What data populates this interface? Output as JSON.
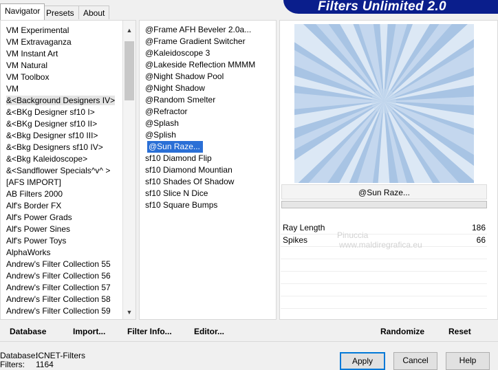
{
  "tabs": [
    {
      "label": "Navigator",
      "active": true
    },
    {
      "label": "Presets",
      "active": false
    },
    {
      "label": "About",
      "active": false
    }
  ],
  "app_title": "Filters Unlimited 2.0",
  "categories": [
    {
      "label": "VM Experimental"
    },
    {
      "label": "VM Extravaganza"
    },
    {
      "label": "VM Instant Art"
    },
    {
      "label": "VM Natural"
    },
    {
      "label": "VM Toolbox"
    },
    {
      "label": "VM"
    },
    {
      "label": "&<Background Designers IV>",
      "selected": true
    },
    {
      "label": "&<BKg Designer sf10 I>"
    },
    {
      "label": "&<BKg Designer sf10 II>"
    },
    {
      "label": "&<Bkg Designer sf10 III>"
    },
    {
      "label": "&<Bkg Designers sf10 IV>"
    },
    {
      "label": "&<Bkg Kaleidoscope>"
    },
    {
      "label": "&<Sandflower Specials^v^ >"
    },
    {
      "label": "[AFS IMPORT]"
    },
    {
      "label": "AB Filters 2000"
    },
    {
      "label": "Alf's Border FX"
    },
    {
      "label": "Alf's Power Grads"
    },
    {
      "label": "Alf's Power Sines"
    },
    {
      "label": "Alf's Power Toys"
    },
    {
      "label": "AlphaWorks"
    },
    {
      "label": "Andrew's Filter Collection 55"
    },
    {
      "label": "Andrew's Filter Collection 56"
    },
    {
      "label": "Andrew's Filter Collection 57"
    },
    {
      "label": "Andrew's Filter Collection 58"
    },
    {
      "label": "Andrew's Filter Collection 59"
    }
  ],
  "filters": [
    {
      "label": "@Frame AFH Beveler 2.0a..."
    },
    {
      "label": "@Frame Gradient Switcher"
    },
    {
      "label": "@Kaleidoscope 3"
    },
    {
      "label": "@Lakeside Reflection MMMM"
    },
    {
      "label": "@Night Shadow Pool"
    },
    {
      "label": "@Night Shadow"
    },
    {
      "label": "@Random Smelter"
    },
    {
      "label": "@Refractor"
    },
    {
      "label": "@Splash"
    },
    {
      "label": "@Splish"
    },
    {
      "label": "@Sun Raze...",
      "selected": true
    },
    {
      "label": "sf10 Diamond Flip"
    },
    {
      "label": "sf10 Diamond Mountian"
    },
    {
      "label": "sf10 Shades Of Shadow"
    },
    {
      "label": "sf10 Slice N Dice"
    },
    {
      "label": "sf10 Square Bumps"
    }
  ],
  "selected_filter_name": "@Sun Raze...",
  "params": [
    {
      "label": "Ray Length",
      "value": "186"
    },
    {
      "label": "Spikes",
      "value": "66"
    }
  ],
  "watermark": {
    "name": "Pinuccia",
    "url": "www.maldiregrafica.eu"
  },
  "buttons": {
    "database": "Database",
    "import": "Import...",
    "filter_info": "Filter Info...",
    "editor": "Editor...",
    "randomize": "Randomize",
    "reset": "Reset",
    "apply": "Apply",
    "cancel": "Cancel",
    "help": "Help"
  },
  "status": {
    "database_label": "Database:",
    "database_value": "ICNET-Filters",
    "filters_label": "Filters:",
    "filters_value": "1164"
  },
  "colors": {
    "banner": "#0a1e8c",
    "selection": "#2a6fd6",
    "preview": "#a8c4e4"
  }
}
